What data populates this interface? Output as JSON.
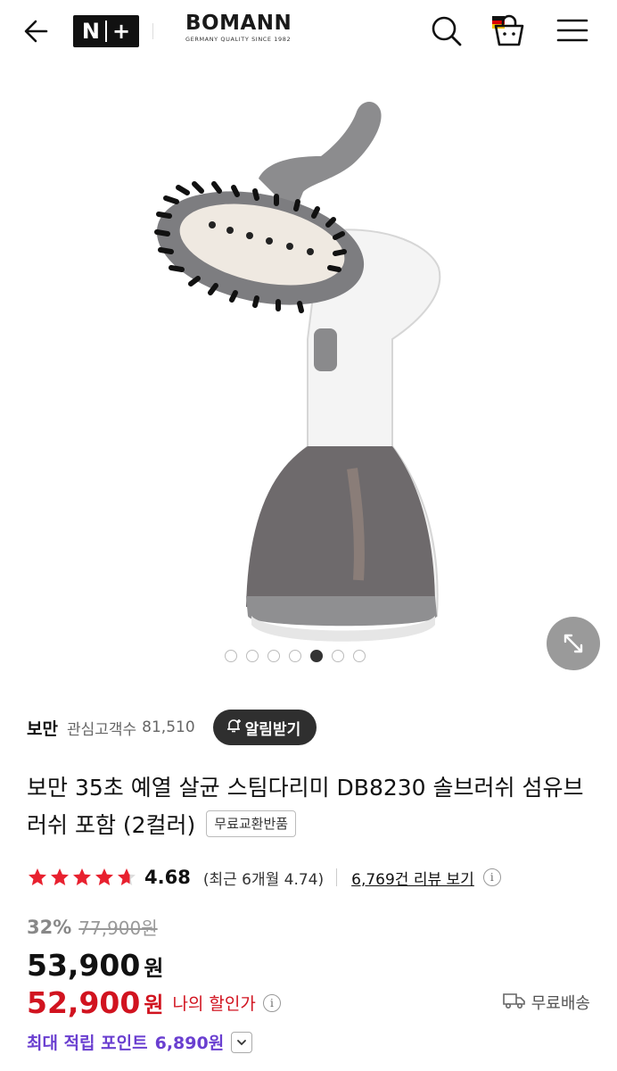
{
  "header": {
    "back_icon": "arrow-left-icon",
    "nplus_n": "N",
    "nplus_plus": "+",
    "brand_name": "BOMANN",
    "brand_tagline": "GERMANY QUALITY SINCE 1982",
    "search_icon": "search-icon",
    "bag_icon": "shopping-bag-icon",
    "menu_icon": "menu-icon"
  },
  "gallery": {
    "image_count": 7,
    "active_index": 4,
    "expand_icon": "expand-icon"
  },
  "seller": {
    "brand": "보만",
    "fans_label": "관심고객수",
    "fans_count": "81,510",
    "alarm_label": "알림받기",
    "alarm_icon": "bell-plus-icon"
  },
  "product": {
    "title": "보만 35초 예열 살균 스팀다리미 DB8230 솔브러쉬 섬유브러쉬 포함 (2컬러)",
    "tag": "무료교환반품"
  },
  "rating": {
    "stars": 4.68,
    "score": "4.68",
    "recent": "(최근 6개월 4.74)",
    "reviews": "6,769건 리뷰 보기",
    "info_icon": "info-icon"
  },
  "price": {
    "discount": "32%",
    "original": "77,900원",
    "current": "53,900",
    "current_unit": "원",
    "my_price": "52,900",
    "my_price_unit": "원",
    "my_price_label": "나의 할인가",
    "shipping": "무료배송",
    "shipping_icon": "truck-icon"
  },
  "points": {
    "label": "최대 적립 포인트",
    "value": "6,890원",
    "toggle_icon": "chevron-down-icon"
  },
  "colors": {
    "accent_red": "#d1131f",
    "points_purple": "#6a3fd0",
    "star": "#e8212f"
  }
}
